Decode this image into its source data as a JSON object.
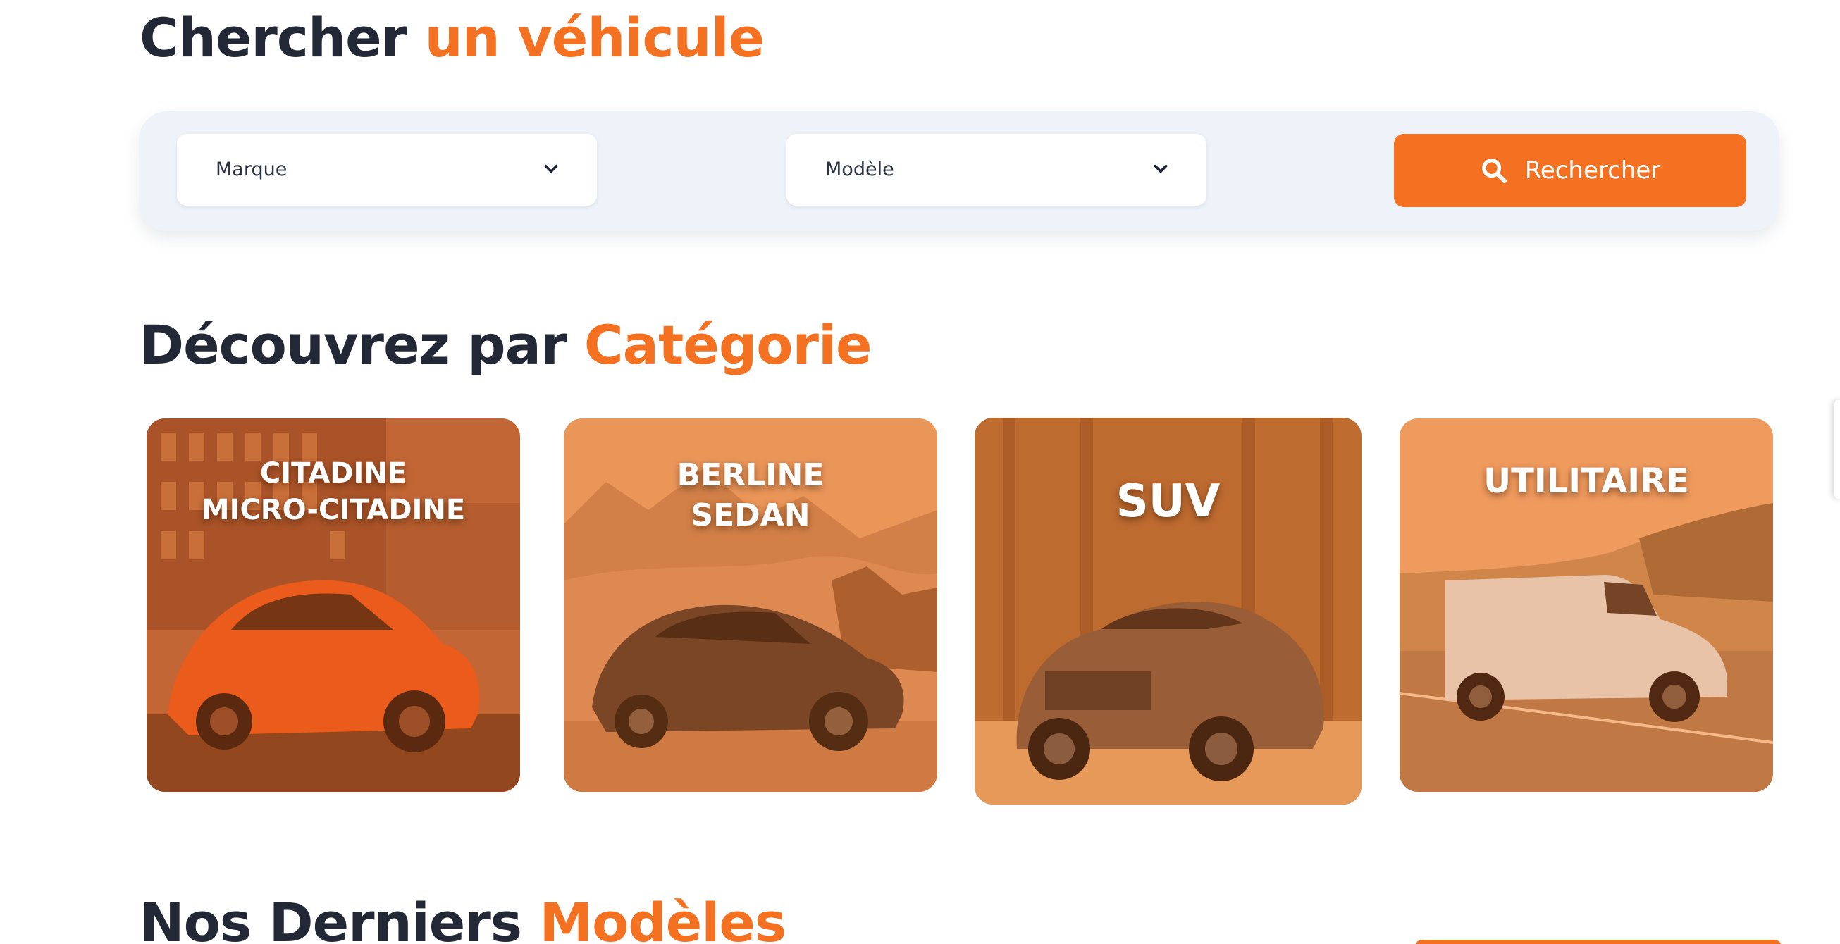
{
  "search_section": {
    "title_main": "Chercher",
    "title_accent": "un véhicule",
    "brand_select": {
      "selected": "Marque"
    },
    "model_select": {
      "selected": "Modèle"
    },
    "search_button": {
      "label": "Rechercher",
      "icon": "search-icon"
    }
  },
  "category_section": {
    "title_main": "Découvrez par",
    "title_accent": "Catégorie",
    "cards": [
      {
        "line1": "CITADINE",
        "line2": "MICRO-CITADINE"
      },
      {
        "line1": "BERLINE",
        "line2": "SEDAN"
      },
      {
        "line1": "SUV"
      },
      {
        "line1": "UTILITAIRE"
      }
    ]
  },
  "latest_section": {
    "title_main": "Nos Derniers",
    "title_accent": "Modèles"
  },
  "colors": {
    "accent": "#f37121",
    "heading": "#232836",
    "panel": "#eef3f9"
  }
}
